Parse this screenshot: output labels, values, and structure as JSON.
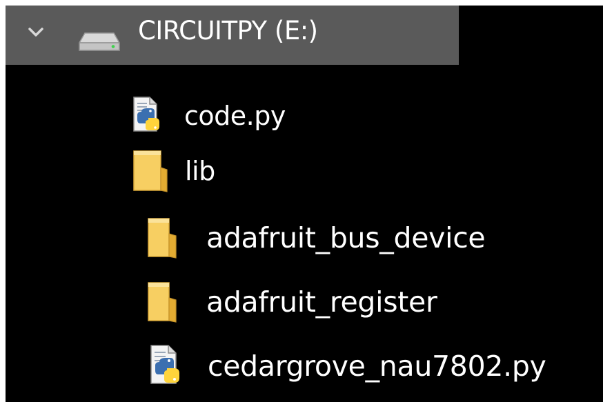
{
  "tree": {
    "drive": {
      "label": "CIRCUITPY (E:)",
      "expand_icon": "chevron-down-icon",
      "icon": "drive-icon"
    },
    "items": [
      {
        "name": "code.py",
        "icon": "python-file-icon",
        "level": 1
      },
      {
        "name": "lib",
        "icon": "folder-icon",
        "level": 1
      },
      {
        "name": "adafruit_bus_device",
        "icon": "folder-icon",
        "level": 2
      },
      {
        "name": "adafruit_register",
        "icon": "folder-icon",
        "level": 2
      },
      {
        "name": "cedargrove_nau7802.py",
        "icon": "python-file-icon",
        "level": 2
      }
    ]
  },
  "colors": {
    "panel_background": "#000000",
    "drive_row_background": "#5a5a5a",
    "text": "#ffffff",
    "folder_yellow": "#f7cf62",
    "python_blue": "#3b6fb0",
    "python_yellow": "#ffd43b"
  }
}
